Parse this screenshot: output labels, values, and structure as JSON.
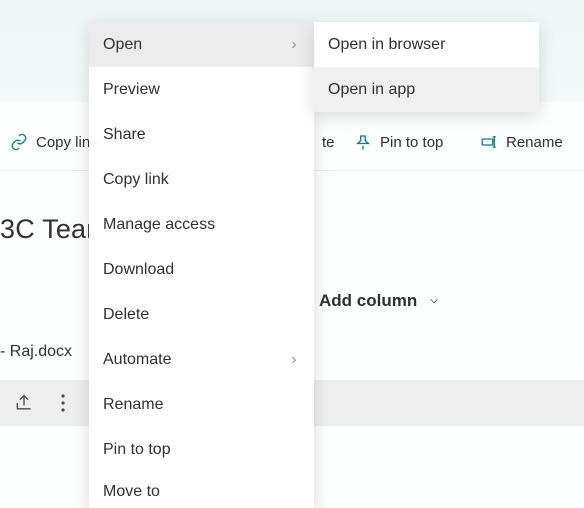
{
  "toolbar": {
    "copy_link": "Copy lin",
    "delete_fragment": "te",
    "pin_to_top": "Pin to top",
    "rename": "Rename"
  },
  "team_title": "3C Team",
  "add_column_label": "Add column",
  "filename": "- Raj.docx",
  "context_menu": {
    "open": "Open",
    "preview": "Preview",
    "share": "Share",
    "copy_link": "Copy link",
    "manage_access": "Manage access",
    "download": "Download",
    "delete": "Delete",
    "automate": "Automate",
    "rename": "Rename",
    "pin_to_top": "Pin to top",
    "move_to": "Move to"
  },
  "submenu": {
    "open_in_browser": "Open in browser",
    "open_in_app": "Open in app"
  }
}
